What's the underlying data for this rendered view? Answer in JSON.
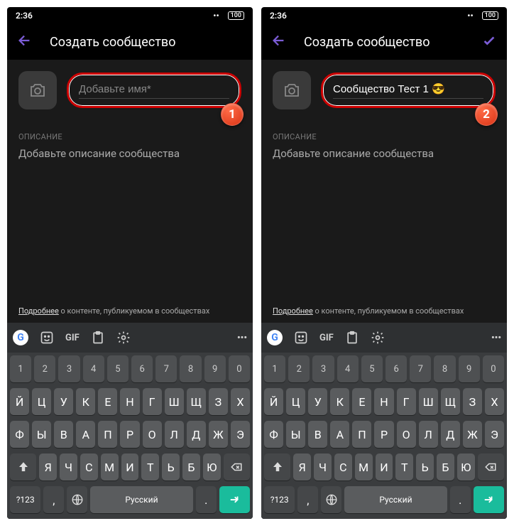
{
  "statusBar": {
    "time": "2:36",
    "battery": "100"
  },
  "screens": [
    {
      "title": "Создать сообщество",
      "showCheck": false,
      "nameValue": "",
      "namePlaceholder": "Добавьте имя*",
      "badge": "1"
    },
    {
      "title": "Создать сообщество",
      "showCheck": true,
      "nameValue": "Сообщество Тест 1 😎",
      "namePlaceholder": "Добавьте имя*",
      "badge": "2"
    }
  ],
  "sectionLabel": "ОПИСАНИЕ",
  "descriptionPlaceholder": "Добавьте описание сообщества",
  "footerLink": "Подробнее",
  "footerRest": " о контенте, публикуемом в сообществах",
  "keyboard": {
    "gif": "GIF",
    "numbers": [
      "1",
      "2",
      "3",
      "4",
      "5",
      "6",
      "7",
      "8",
      "9",
      "0"
    ],
    "row1": [
      "Й",
      "Ц",
      "У",
      "К",
      "Е",
      "Н",
      "Г",
      "Ш",
      "Щ",
      "З",
      "Х"
    ],
    "row2": [
      "Ф",
      "Ы",
      "В",
      "А",
      "П",
      "Р",
      "О",
      "Л",
      "Д",
      "Ж",
      "Э"
    ],
    "row3": [
      "Я",
      "Ч",
      "С",
      "М",
      "И",
      "Т",
      "Ь",
      "Б",
      "Ю"
    ],
    "symKey": "?123",
    "langLabel": "Русский",
    "comma": ",",
    "period": "."
  }
}
